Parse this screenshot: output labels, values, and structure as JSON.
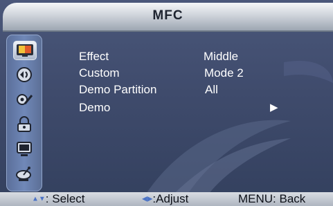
{
  "header": {
    "title": "MFC"
  },
  "sidebar": {
    "items": [
      {
        "icon": "picture-icon",
        "active": true
      },
      {
        "icon": "sound-icon",
        "active": false
      },
      {
        "icon": "setup-icon",
        "active": false
      },
      {
        "icon": "lock-icon",
        "active": false
      },
      {
        "icon": "pc-icon",
        "active": false
      },
      {
        "icon": "channel-icon",
        "active": false
      }
    ]
  },
  "menu": {
    "rows": [
      {
        "label": "Effect",
        "value": "Middle"
      },
      {
        "label": "Custom",
        "value": "Mode 2"
      },
      {
        "label": "Demo Partition",
        "value": "All"
      },
      {
        "label": "Demo",
        "value": "▶"
      }
    ]
  },
  "footer": {
    "select_label": ": Select",
    "adjust_label": ":Adjust",
    "back_label": "MENU: Back"
  },
  "colors": {
    "accent": "#4b73c6",
    "background": "#3f4b6c",
    "title_bar": "#cfd4db"
  }
}
